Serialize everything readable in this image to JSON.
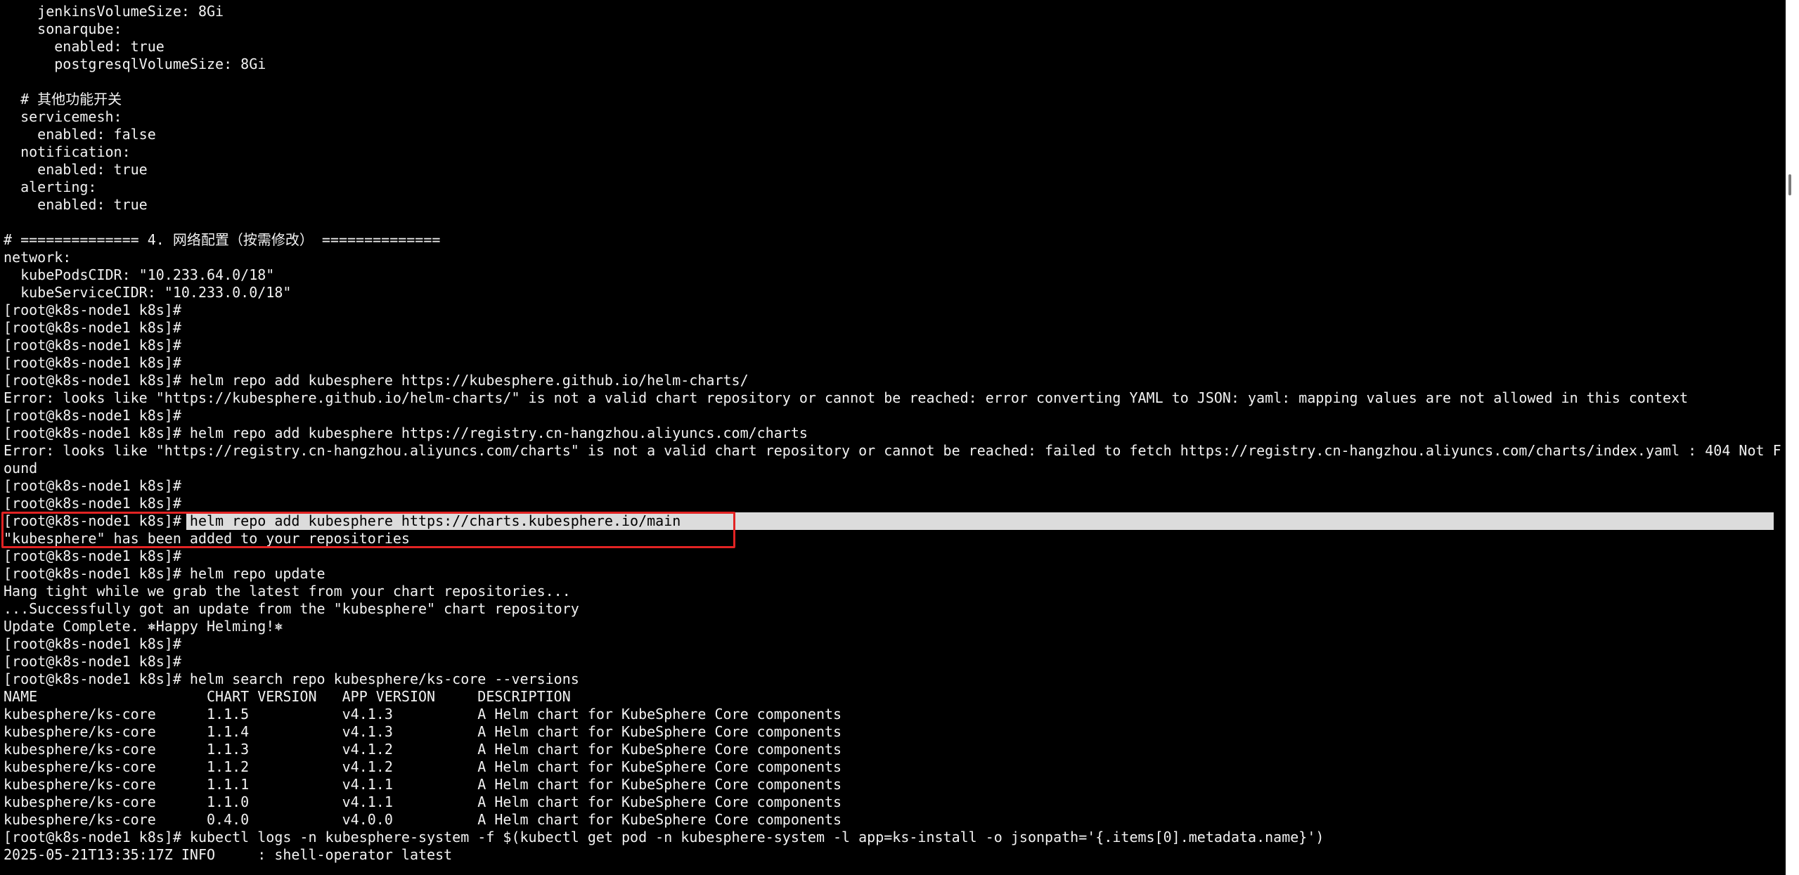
{
  "terminal": {
    "lines": [
      "    jenkinsVolumeSize: 8Gi",
      "    sonarqube:",
      "      enabled: true",
      "      postgresqlVolumeSize: 8Gi",
      "",
      "  # 其他功能开关",
      "  servicemesh:",
      "    enabled: false",
      "  notification:",
      "    enabled: true",
      "  alerting:",
      "    enabled: true",
      "",
      "# ============== 4. 网络配置（按需修改） ==============",
      "network:",
      "  kubePodsCIDR: \"10.233.64.0/18\"",
      "  kubeServiceCIDR: \"10.233.0.0/18\"",
      "[root@k8s-node1 k8s]#",
      "[root@k8s-node1 k8s]#",
      "[root@k8s-node1 k8s]#",
      "[root@k8s-node1 k8s]#",
      "[root@k8s-node1 k8s]# helm repo add kubesphere https://kubesphere.github.io/helm-charts/",
      "Error: looks like \"https://kubesphere.github.io/helm-charts/\" is not a valid chart repository or cannot be reached: error converting YAML to JSON: yaml: mapping values are not allowed in this context",
      "[root@k8s-node1 k8s]#",
      "[root@k8s-node1 k8s]# helm repo add kubesphere https://registry.cn-hangzhou.aliyuncs.com/charts",
      "Error: looks like \"https://registry.cn-hangzhou.aliyuncs.com/charts\" is not a valid chart repository or cannot be reached: failed to fetch https://registry.cn-hangzhou.aliyuncs.com/charts/index.yaml : 404 Not F",
      "ound",
      "[root@k8s-node1 k8s]#",
      "[root@k8s-node1 k8s]#"
    ],
    "selected_prompt": "[root@k8s-node1 k8s]# ",
    "selected_command": "helm repo add kubesphere https://charts.kubesphere.io/main",
    "lines_after": [
      "\"kubesphere\" has been added to your repositories",
      "[root@k8s-node1 k8s]#",
      "[root@k8s-node1 k8s]# helm repo update",
      "Hang tight while we grab the latest from your chart repositories...",
      "...Successfully got an update from the \"kubesphere\" chart repository",
      "Update Complete. ⎈Happy Helming!⎈",
      "[root@k8s-node1 k8s]#",
      "[root@k8s-node1 k8s]#",
      "[root@k8s-node1 k8s]# helm search repo kubesphere/ks-core --versions",
      "NAME                    CHART VERSION   APP VERSION     DESCRIPTION",
      "kubesphere/ks-core      1.1.5           v4.1.3          A Helm chart for KubeSphere Core components",
      "kubesphere/ks-core      1.1.4           v4.1.3          A Helm chart for KubeSphere Core components",
      "kubesphere/ks-core      1.1.3           v4.1.2          A Helm chart for KubeSphere Core components",
      "kubesphere/ks-core      1.1.2           v4.1.2          A Helm chart for KubeSphere Core components",
      "kubesphere/ks-core      1.1.1           v4.1.1          A Helm chart for KubeSphere Core components",
      "kubesphere/ks-core      1.1.0           v4.1.1          A Helm chart for KubeSphere Core components",
      "kubesphere/ks-core      0.4.0           v4.0.0          A Helm chart for KubeSphere Core components",
      "[root@k8s-node1 k8s]# kubectl logs -n kubesphere-system -f $(kubectl get pod -n kubesphere-system -l app=ks-install -o jsonpath='{.items[0].metadata.name}')",
      "2025-05-21T13:35:17Z INFO     : shell-operator latest"
    ]
  },
  "colors": {
    "background": "#000000",
    "text": "#f2f2f2",
    "selection": "#dcdcdc",
    "annotation_box": "#e22323",
    "scrollbar": "#ffffff"
  }
}
